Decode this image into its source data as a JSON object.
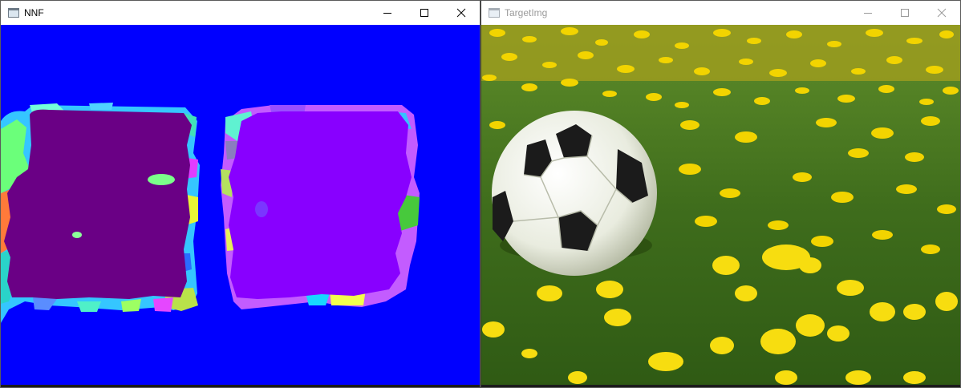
{
  "windows": {
    "nnf": {
      "title": "NNF",
      "active": true,
      "icon": "app-window-icon"
    },
    "target": {
      "title": "TargetImg",
      "active": false,
      "icon": "app-window-icon"
    }
  },
  "controls": [
    "minimize-icon",
    "maximize-icon",
    "close-icon"
  ],
  "colors": {
    "nnf_background": "#0000ff",
    "nnf_left_region": "#6a0085",
    "nnf_right_region": "#8800ff",
    "grass": "#4e7a22",
    "dandelion": "#f2d400"
  }
}
